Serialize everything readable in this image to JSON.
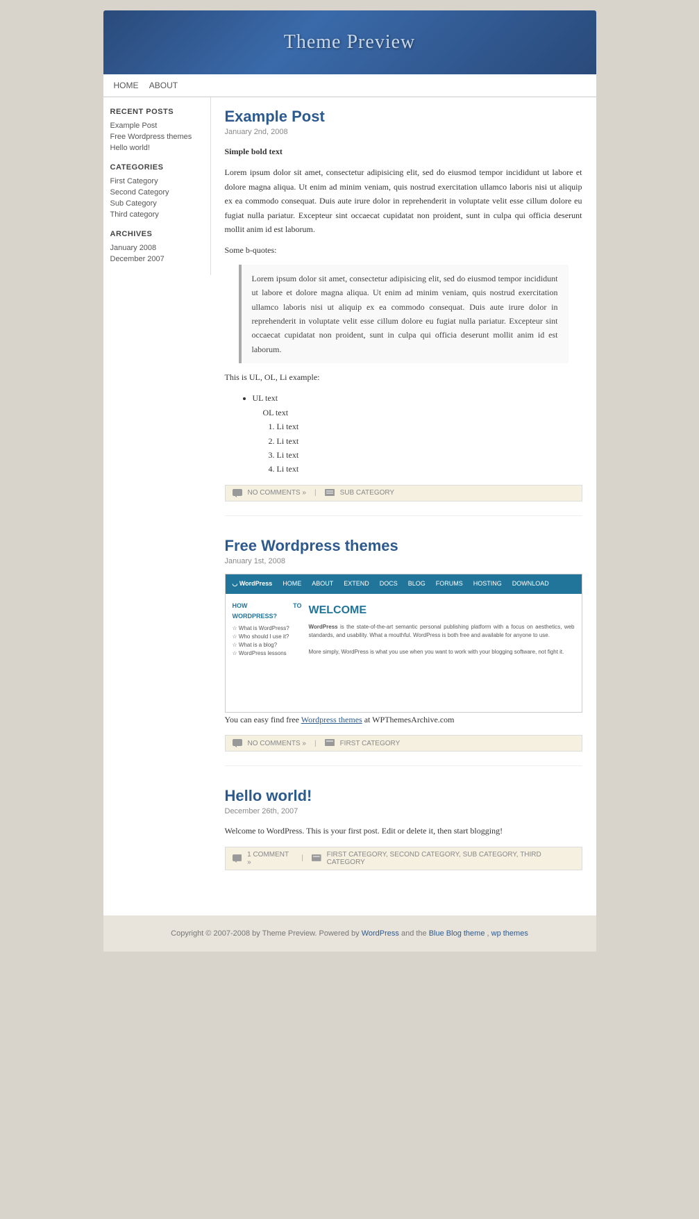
{
  "site": {
    "title": "Theme Preview"
  },
  "nav": {
    "items": [
      {
        "label": "HOME",
        "url": "#"
      },
      {
        "label": "ABOUT",
        "url": "#"
      }
    ]
  },
  "sidebar": {
    "recent_posts_title": "RECENT POSTS",
    "recent_posts": [
      {
        "label": "Example Post"
      },
      {
        "label": "Free Wordpress themes"
      },
      {
        "label": "Hello world!"
      }
    ],
    "categories_title": "CATEGORIES",
    "categories": [
      {
        "label": "First Category"
      },
      {
        "label": "Second Category"
      },
      {
        "label": "Sub Category"
      },
      {
        "label": "Third category"
      }
    ],
    "archives_title": "ARCHIVES",
    "archives": [
      {
        "label": "January 2008"
      },
      {
        "label": "December 2007"
      }
    ]
  },
  "posts": [
    {
      "title": "Example Post",
      "date": "January 2nd, 2008",
      "bold_label": "Simple bold text",
      "body": "Lorem ipsum dolor sit amet, consectetur adipisicing elit, sed do eiusmod tempor incididunt ut labore et dolore magna aliqua. Ut enim ad minim veniam, quis nostrud exercitation ullamco laboris nisi ut aliquip ex ea commodo consequat. Duis aute irure dolor in reprehenderit in voluptate velit esse cillum dolore eu fugiat nulla pariatur. Excepteur sint occaecat cupidatat non proident, sunt in culpa qui officia deserunt mollit anim id est laborum.",
      "bquote_intro": "Some b-quotes:",
      "blockquote": "Lorem ipsum dolor sit amet, consectetur adipisicing elit, sed do eiusmod tempor incididunt ut labore et dolore magna aliqua. Ut enim ad minim veniam, quis nostrud exercitation ullamco laboris nisi ut aliquip ex ea commodo consequat. Duis aute irure dolor in reprehenderit in voluptate velit esse cillum dolore eu fugiat nulla pariatur. Excepteur sint occaecat cupidatat non proident, sunt in culpa qui officia deserunt mollit anim id est laborum.",
      "list_intro": "This is UL, OL, Li example:",
      "ul_item": "UL text",
      "ol_item": "OL text",
      "li_items": [
        "Li text",
        "Li text",
        "Li text",
        "Li text"
      ],
      "footer": {
        "no_comments": "NO COMMENTS »",
        "pipe": "|",
        "category": "SUB CATEGORY"
      }
    },
    {
      "title": "Free Wordpress themes",
      "date": "January 1st, 2008",
      "body_pre": "You can easy find free",
      "link_text": "Wordpress themes",
      "body_post": "at WPThemesArchive.com",
      "footer": {
        "no_comments": "NO COMMENTS »",
        "pipe": "|",
        "category": "FIRST CATEGORY"
      }
    },
    {
      "title": "Hello world!",
      "date": "December 26th, 2007",
      "body": "Welcome to WordPress. This is your first post. Edit or delete it, then start blogging!",
      "footer": {
        "comment": "1 COMMENT »",
        "pipe": "|",
        "categories": "FIRST CATEGORY, SECOND CATEGORY, SUB CATEGORY, THIRD CATEGORY"
      }
    }
  ],
  "footer": {
    "copyright": "Copyright © 2007-2008 by Theme Preview. Powered by",
    "wordpress_link": "WordPress",
    "and": "and the",
    "theme_link": "Blue Blog theme",
    "separator": ",",
    "wp_themes_link": "wp themes"
  }
}
